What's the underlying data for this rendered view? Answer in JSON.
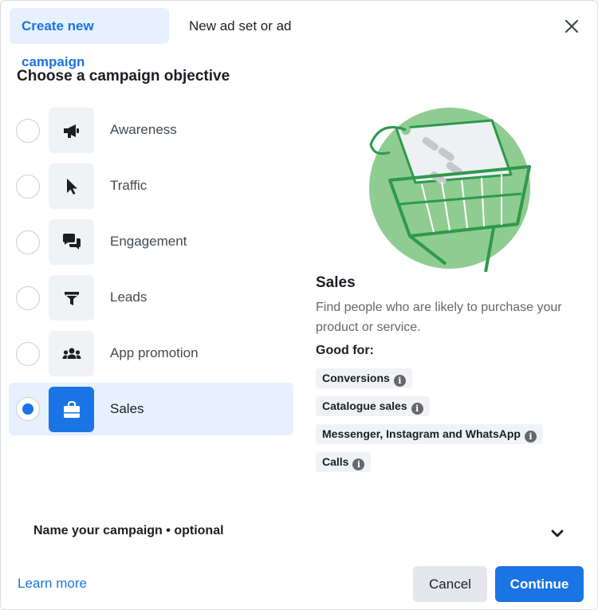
{
  "tabs": [
    {
      "label": "Create new campaign",
      "active": true
    },
    {
      "label": "New ad set or ad",
      "active": false
    }
  ],
  "section_title": "Choose a campaign objective",
  "objectives": [
    {
      "label": "Awareness",
      "icon": "megaphone-icon",
      "selected": false
    },
    {
      "label": "Traffic",
      "icon": "cursor-icon",
      "selected": false
    },
    {
      "label": "Engagement",
      "icon": "chat-bubbles-icon",
      "selected": false
    },
    {
      "label": "Leads",
      "icon": "funnel-icon",
      "selected": false
    },
    {
      "label": "App promotion",
      "icon": "people-icon",
      "selected": false
    },
    {
      "label": "Sales",
      "icon": "shopping-bag-icon",
      "selected": true
    }
  ],
  "detail": {
    "title": "Sales",
    "description": "Find people who are likely to purchase your product or service.",
    "good_for_label": "Good for:",
    "chips": [
      "Conversions",
      "Catalogue sales",
      "Messenger, Instagram and WhatsApp",
      "Calls"
    ]
  },
  "name_campaign": "Name your campaign • optional",
  "footer": {
    "learn_more": "Learn more",
    "cancel": "Cancel",
    "continue": "Continue"
  },
  "colors": {
    "accent": "#1b74e4",
    "selected_bg": "#e7f0fd",
    "illustration_green": "#8fcc92"
  }
}
